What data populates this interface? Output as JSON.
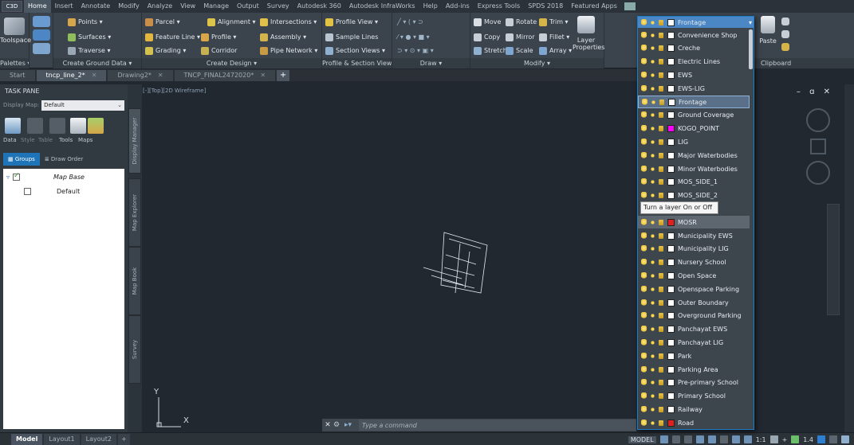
{
  "app_button": "C3D",
  "ribbon_tabs": [
    "Home",
    "Insert",
    "Annotate",
    "Modify",
    "Analyze",
    "View",
    "Manage",
    "Output",
    "Survey",
    "Autodesk 360",
    "Autodesk InfraWorks",
    "Help",
    "Add-ins",
    "Express Tools",
    "SPDS 2018",
    "Featured Apps"
  ],
  "ribbon": {
    "palettes": {
      "toolspace": "Toolspace",
      "title": "Palettes ▾"
    },
    "ground": {
      "points": "Points ▾",
      "surfaces": "Surfaces ▾",
      "traverse": "Traverse ▾",
      "title": "Create Ground Data ▾"
    },
    "design": {
      "parcel": "Parcel ▾",
      "feature_line": "Feature Line ▾",
      "grading": "Grading ▾",
      "profile": "Profile ▾",
      "corridor": "Corridor",
      "alignment": "Alignment ▾",
      "intersections": "Intersections ▾",
      "assembly": "Assembly ▾",
      "pipe_network": "Pipe Network ▾",
      "title": "Create Design ▾"
    },
    "profile_views": {
      "profile_view": "Profile View ▾",
      "sample_lines": "Sample Lines",
      "section_views": "Section Views ▾",
      "title": "Profile & Section Views"
    },
    "draw": {
      "title": "Draw ▾"
    },
    "modify": {
      "move": "Move",
      "rotate": "Rotate",
      "trim": "Trim ▾",
      "copy": "Copy",
      "mirror": "Mirror",
      "fillet": "Fillet ▾",
      "stretch": "Stretch",
      "scale": "Scale",
      "array": "Array ▾",
      "title": "Modify ▾"
    },
    "layer": {
      "properties": "Layer",
      "properties2": "Properties"
    },
    "clipboard": {
      "paste": "Paste",
      "title": "Clipboard"
    }
  },
  "doc_tabs": [
    {
      "label": "Start",
      "active": false
    },
    {
      "label": "tncp_line_2*",
      "active": true
    },
    {
      "label": "Drawing2*",
      "active": false
    },
    {
      "label": "TNCP_FINAL2472020*",
      "active": false
    }
  ],
  "task_pane": {
    "title": "TASK PANE",
    "display_map_label": "Display Map:",
    "display_map_value": "Default",
    "icon_labels": [
      "Data",
      "Style",
      "Table",
      "Tools",
      "Maps"
    ],
    "tabs": [
      "Groups",
      "Draw Order"
    ],
    "tree": [
      {
        "label": "Map Base"
      },
      {
        "label": "Default"
      }
    ],
    "side_tabs": [
      "Display Manager",
      "Map Explorer",
      "Map Book",
      "Survey"
    ]
  },
  "canvas": {
    "view_label": "[-][Top][2D Wireframe]",
    "win_controls": "– ɑ ✕",
    "ucs_y": "Y",
    "ucs_x": "X"
  },
  "command": {
    "placeholder": "Type a command"
  },
  "layouts": [
    "Model",
    "Layout1",
    "Layout2"
  ],
  "status": {
    "model": "MODEL",
    "scale": "1:1",
    "scale2": "1.4"
  },
  "layer_dropdown": {
    "current": "Frontage",
    "tooltip": "Turn a layer On or Off",
    "layers": [
      {
        "name": "Convenience Shop",
        "color": "#ffffff"
      },
      {
        "name": "Creche",
        "color": "#ffffff"
      },
      {
        "name": "Electric Lines",
        "color": "#ffffff"
      },
      {
        "name": "EWS",
        "color": "#ffffff"
      },
      {
        "name": "EWS-LIG",
        "color": "#ffffff"
      },
      {
        "name": "Frontage",
        "color": "#ffffff",
        "state": "highlighted"
      },
      {
        "name": "Ground Coverage",
        "color": "#ffffff"
      },
      {
        "name": "KOGO_POINT",
        "color": "#ff00ff"
      },
      {
        "name": "LIG",
        "color": "#ffffff"
      },
      {
        "name": "Major Waterbodies",
        "color": "#ffffff"
      },
      {
        "name": "Minor Waterbodies",
        "color": "#ffffff"
      },
      {
        "name": "MOS_SIDE_1",
        "color": "#ffffff"
      },
      {
        "name": "MOS_SIDE_2",
        "color": "#ffffff"
      },
      {
        "name": "",
        "color": "#ffffff"
      },
      {
        "name": "MOSR",
        "color": "#e02020",
        "state": "selected"
      },
      {
        "name": "Municipality EWS",
        "color": "#ffffff"
      },
      {
        "name": "Municipality LIG",
        "color": "#ffffff"
      },
      {
        "name": "Nursery School",
        "color": "#ffffff"
      },
      {
        "name": "Open Space",
        "color": "#ffffff"
      },
      {
        "name": "Openspace Parking",
        "color": "#ffffff"
      },
      {
        "name": "Outer Boundary",
        "color": "#ffffff"
      },
      {
        "name": "Overground Parking",
        "color": "#ffffff"
      },
      {
        "name": "Panchayat EWS",
        "color": "#ffffff"
      },
      {
        "name": "Panchayat LIG",
        "color": "#ffffff"
      },
      {
        "name": "Park",
        "color": "#ffffff"
      },
      {
        "name": "Parking Area",
        "color": "#ffffff"
      },
      {
        "name": "Pre-primary School",
        "color": "#ffffff"
      },
      {
        "name": "Primary School",
        "color": "#ffffff"
      },
      {
        "name": "Railway",
        "color": "#ffffff"
      },
      {
        "name": "Road",
        "color": "#e02020"
      }
    ]
  }
}
